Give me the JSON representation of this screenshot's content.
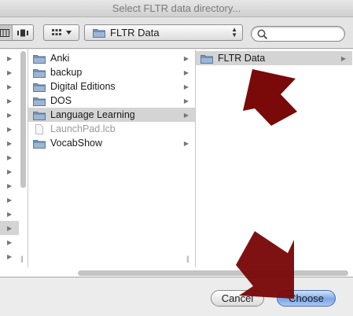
{
  "window": {
    "title": "Select FLTR data directory..."
  },
  "toolbar": {
    "view_buttons": [
      "icon-view",
      "list-view",
      "column-view"
    ],
    "arrange_icon": "arrange-grid-icon",
    "location": "FLTR Data",
    "search_placeholder": ""
  },
  "columns": {
    "left_arrow_count": 15,
    "left_selected_index": 12,
    "middle": [
      {
        "name": "Anki",
        "icon": "folder-icon",
        "has_children": true,
        "selected": false,
        "dimmed": false
      },
      {
        "name": "backup",
        "icon": "folder-icon",
        "has_children": true,
        "selected": false,
        "dimmed": false
      },
      {
        "name": "Digital Editions",
        "icon": "folder-icon",
        "has_children": true,
        "selected": false,
        "dimmed": false
      },
      {
        "name": "DOS",
        "icon": "folder-icon",
        "has_children": true,
        "selected": false,
        "dimmed": false
      },
      {
        "name": "Language Learning",
        "icon": "folder-icon",
        "has_children": true,
        "selected": true,
        "dimmed": false
      },
      {
        "name": "LaunchPad.lcb",
        "icon": "document-icon",
        "has_children": false,
        "selected": false,
        "dimmed": true
      },
      {
        "name": "VocabShow",
        "icon": "folder-icon",
        "has_children": true,
        "selected": false,
        "dimmed": false
      }
    ],
    "right": [
      {
        "name": "FLTR Data",
        "icon": "folder-icon",
        "has_children": true,
        "selected": true,
        "dimmed": false
      }
    ]
  },
  "footer": {
    "cancel_label": "Cancel",
    "choose_label": "Choose"
  },
  "colors": {
    "annotation_arrow": "#7a0a0a",
    "selection": "#d4d4d4",
    "default_button": "#7aa7e6"
  }
}
